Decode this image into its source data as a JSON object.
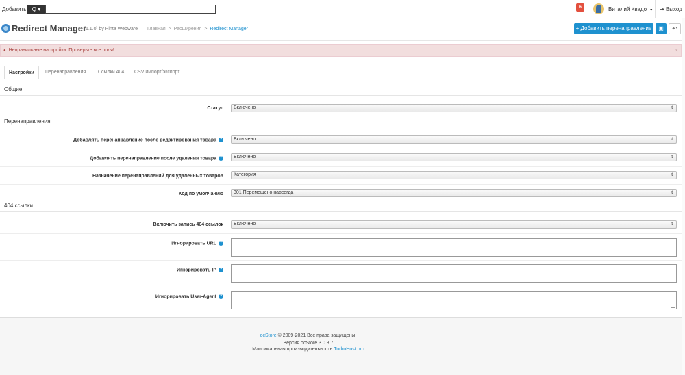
{
  "header": {
    "add_label": "Добавить",
    "search_button": "Q ▾",
    "search_value": "",
    "notification_count": "6",
    "user_name": "Виталий Квадо",
    "user_caret": "▾",
    "logout_icon": "⇥",
    "logout_label": "Выход"
  },
  "page": {
    "title": "Redirect Manager",
    "version": "[1.1.0] by Pinta Webware",
    "breadcrumbs": [
      "Главная",
      "Расширения",
      "Redirect Manager"
    ],
    "breadcrumb_sep": ">",
    "add_redirect_label": "+ Добавить перенаправление",
    "save_icon": "▣",
    "back_icon": "↶"
  },
  "alert": {
    "icon": "●",
    "text": "Неправильные настройки. Проверьте все поля!",
    "close": "×",
    "colors": {
      "bg": "#f2dede",
      "text": "#a94442"
    }
  },
  "tabs": [
    {
      "label": "Настройки",
      "active": true
    },
    {
      "label": "Перенаправления",
      "active": false
    },
    {
      "label": "Ссылки 404",
      "active": false
    },
    {
      "label": "CSV импорт/экспорт",
      "active": false
    }
  ],
  "sections": {
    "general": "Общие",
    "redirects": "Перенаправления",
    "links404": "404 ссылки"
  },
  "fields": {
    "status": {
      "label": "Статус",
      "value": "Включено"
    },
    "add_after_edit": {
      "label": "Добавлять перенаправление после редактирования товара",
      "value": "Включено",
      "help": "?"
    },
    "add_after_delete": {
      "label": "Добавлять перенаправление после удаления товара",
      "value": "Включено",
      "help": "?"
    },
    "deleted_target": {
      "label": "Назначение перенаправлений для удалённых товаров",
      "value": "Категория"
    },
    "default_code": {
      "label": "Код по умолчанию",
      "value": "301 Перемещено навсегда"
    },
    "log_404": {
      "label": "Включить запись 404 ссылок",
      "value": "Включено"
    },
    "ignore_url": {
      "label": "Игнорировать URL",
      "value": "",
      "help": "?"
    },
    "ignore_ip": {
      "label": "Игнорировать IP",
      "value": "",
      "help": "?"
    },
    "ignore_ua": {
      "label": "Игнорировать User-Agent",
      "value": "",
      "help": "?"
    },
    "select_arrow": "⇕"
  },
  "footer": {
    "brand": "ocStore",
    "copyright": "© 2009-2021 Все права защищены.",
    "version": "Версия ocStore 3.0.3.7",
    "perf_prefix": "Максимальная производительность",
    "perf_link": "TurboHost.pro"
  },
  "colors": {
    "accent": "#1e91cf",
    "badge": "#e3503e"
  }
}
